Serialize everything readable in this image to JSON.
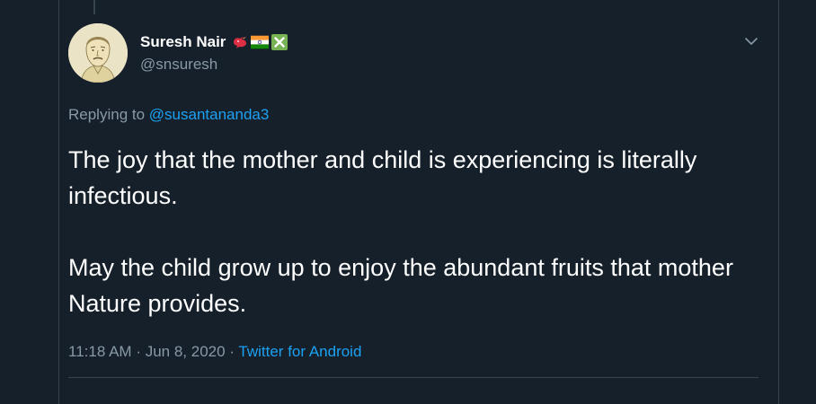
{
  "author": {
    "display_name": "Suresh Nair",
    "handle": "@snsuresh",
    "emojis": [
      "bird-emoji",
      "india-flag-emoji",
      "cross-mark-emoji"
    ]
  },
  "reply": {
    "prefix": "Replying to",
    "mention": "@susantananda3"
  },
  "tweet": {
    "paragraphs": [
      "The joy that the mother and child is experiencing is literally infectious.",
      "May the child grow up to enjoy the abundant fruits that mother Nature provides."
    ]
  },
  "meta": {
    "time": "11:18 AM",
    "separator": "·",
    "date": "Jun 8, 2020",
    "source": "Twitter for Android"
  },
  "colors": {
    "background": "#15202b",
    "text": "#ffffff",
    "secondary_text": "#8899a6",
    "link": "#1da1f2",
    "border": "#38444d"
  }
}
